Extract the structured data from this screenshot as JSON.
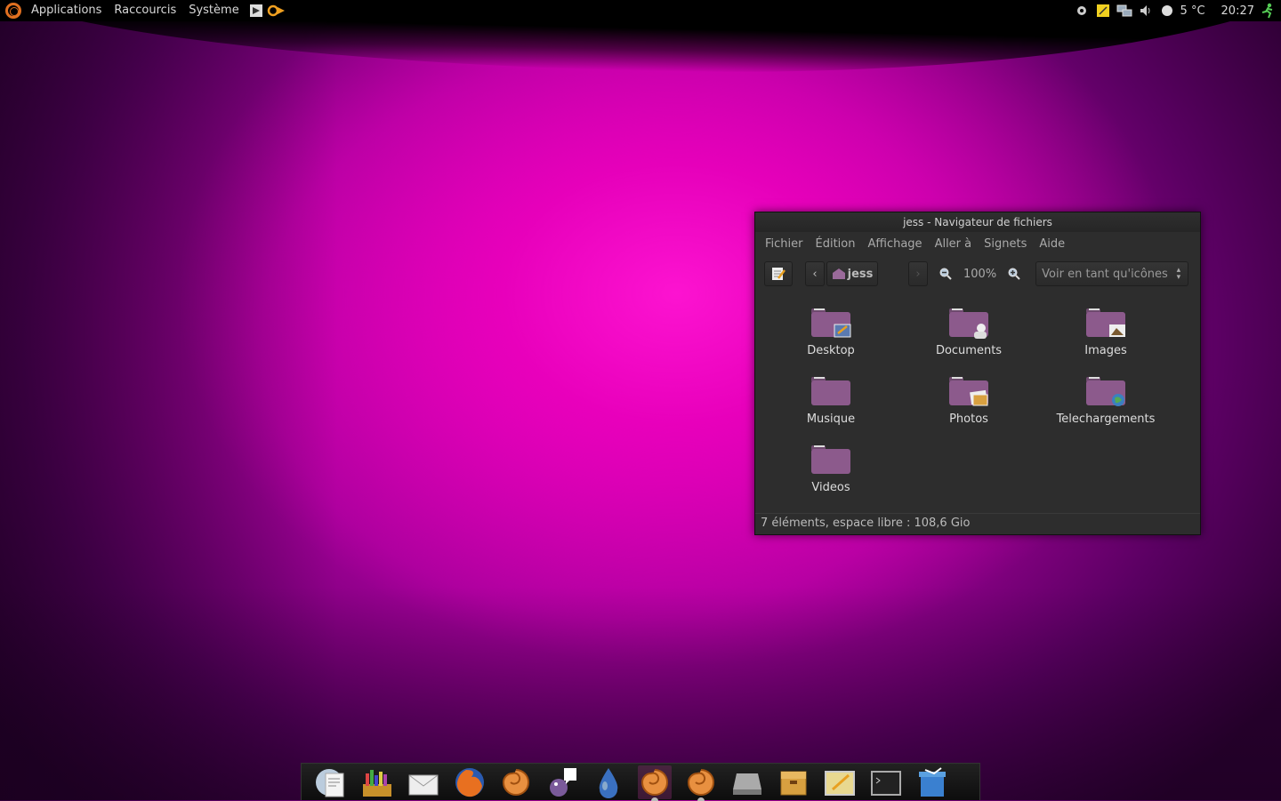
{
  "panel": {
    "menus": [
      "Applications",
      "Raccourcis",
      "Système"
    ],
    "launchers": [
      "gimp-launcher-icon",
      "ojo-launcher-icon"
    ],
    "tray": {
      "weather": "5 °C",
      "clock": "20:27"
    }
  },
  "window": {
    "title": "jess - Navigateur de fichiers",
    "menu": [
      "Fichier",
      "Édition",
      "Affichage",
      "Aller à",
      "Signets",
      "Aide"
    ],
    "toolbar": {
      "location": "jess",
      "zoom": "100%",
      "view_mode": "Voir en tant qu'icônes"
    },
    "items": [
      {
        "label": "Desktop",
        "emblem": "desktop"
      },
      {
        "label": "Documents",
        "emblem": "documents"
      },
      {
        "label": "Images",
        "emblem": "images"
      },
      {
        "label": "Musique",
        "emblem": "none"
      },
      {
        "label": "Photos",
        "emblem": "photos"
      },
      {
        "label": "Telechargements",
        "emblem": "download"
      },
      {
        "label": "Videos",
        "emblem": "none"
      }
    ],
    "status": "7 éléments, espace libre : 108,6 Gio"
  },
  "colors": {
    "folder": "#8c5a8c",
    "accent_orange": "#e07020"
  },
  "dock": [
    "document-viewer-icon",
    "library-icon",
    "mail-icon",
    "firefox-icon",
    "nautilus-icon",
    "pidgin-icon",
    "deluge-icon",
    "nautilus-active-icon",
    "nautilus-running-icon",
    "drive-icon",
    "archive-icon",
    "notes-icon",
    "terminal-icon",
    "trash-icon"
  ]
}
